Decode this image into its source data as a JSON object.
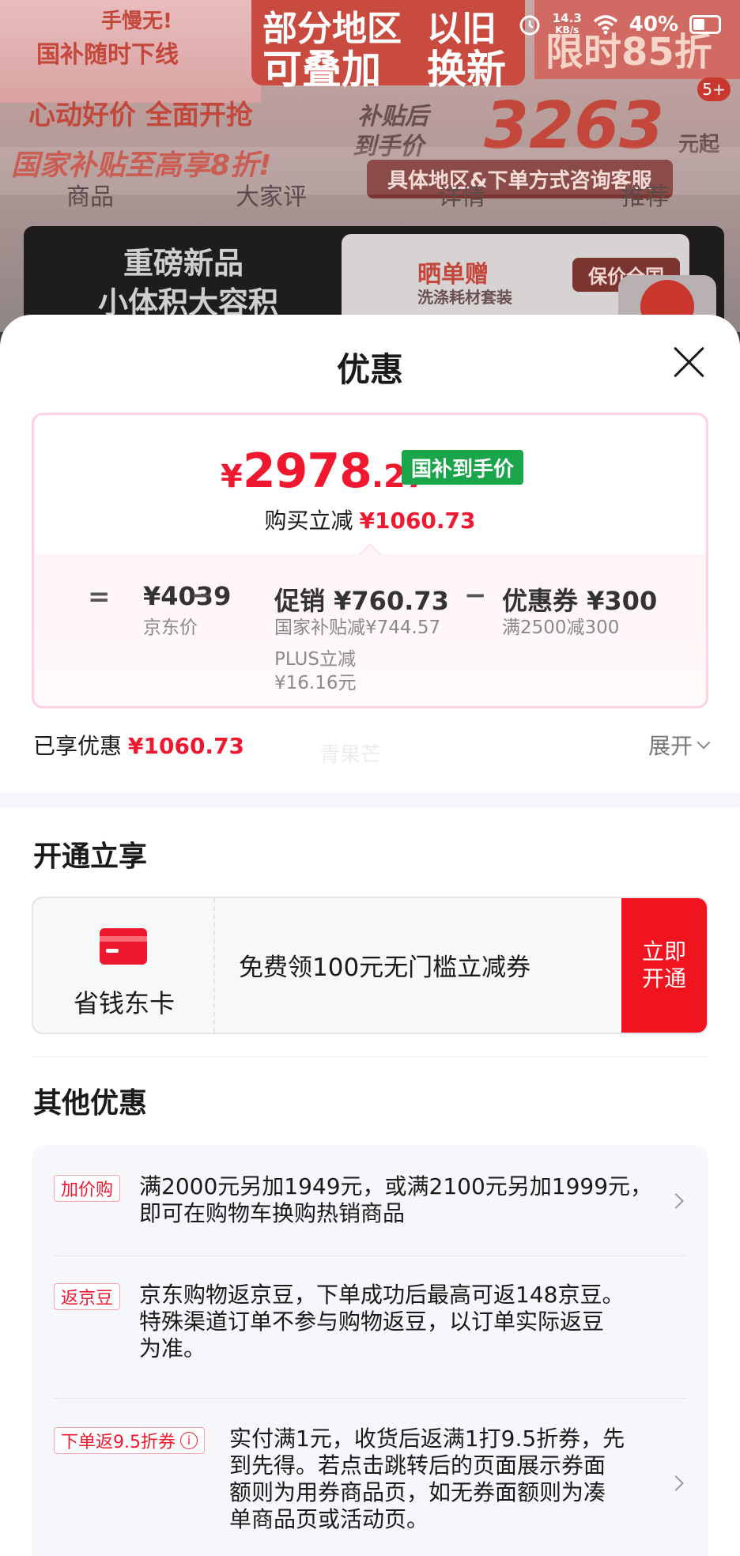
{
  "background": {
    "banner": {
      "left_top": "手慢无!",
      "left_main": "国补随时下线",
      "center_line1": "部分地区",
      "center_line2": "可叠加",
      "center_right1": "以旧",
      "center_right2": "换新",
      "right": "限时85折"
    },
    "slogan": "心动好价 全面开抢",
    "subsidy_text": "国家补贴至高享8折!",
    "after_subsidy_label_1": "补贴后",
    "after_subsidy_label_2": "到手价",
    "after_subsidy_price": "3263",
    "after_subsidy_unit": "元起",
    "consult_text": "具体地区&下单方式咨询客服",
    "badge": "5+",
    "nav_tabs": [
      "商品",
      "大家评",
      "详情",
      "推荐"
    ],
    "promo_left_1": "重磅新品",
    "promo_left_2": "小体积大容积",
    "promo_gift_title": "晒单赠",
    "promo_gift_sub": "洗涤耗材套装",
    "promo_pill": "保价全国"
  },
  "status_bar": {
    "speed_value": "14.3",
    "speed_unit": "KB/s",
    "battery": "40%"
  },
  "sheet": {
    "title": "优惠",
    "price": {
      "yen": "¥",
      "integer": "2978",
      "decimal": ".27",
      "tag": "国补到手价",
      "discount_label": "购买立减",
      "discount_value": "¥1060.73"
    },
    "breakdown": {
      "equals": "=",
      "minus": "−",
      "jd_price": "¥4039",
      "jd_price_label": "京东价",
      "promo": "促销 ¥760.73",
      "promo_sub_1": "国家补贴减¥744.57",
      "promo_sub_2": "PLUS立减",
      "promo_sub_3": "¥16.16元",
      "coupon": "优惠券 ¥300",
      "coupon_sub": "满2500减300"
    },
    "enjoyed_label": "已享优惠",
    "enjoyed_value": "¥1060.73",
    "ghost_text": "青果芒",
    "expand_label": "展开",
    "open_section": {
      "title": "开通立享",
      "card_name": "省钱东卡",
      "card_desc": "免费领100元无门槛立减券",
      "btn_line1": "立即",
      "btn_line2": "开通"
    },
    "other_section": {
      "title": "其他优惠",
      "items": [
        {
          "tag": "加价购",
          "line1": "满2000元另加1949元，或满2100元另加1999元，",
          "line2": "即可在购物车换购热销商品"
        },
        {
          "tag": "返京豆",
          "line1": "京东购物返京豆，下单成功后最高可返148京豆。",
          "line2": "特殊渠道订单不参与购物返豆，以订单实际返豆",
          "line3": "为准。"
        },
        {
          "tag": "下单返9.5折券",
          "line1": "实付满1元，收货后返满1打9.5折券，先",
          "line2": "到先得。若点击跳转后的页面展示券面",
          "line3": "额则为用券商品页，如无券面额则为凑",
          "line4": "单商品页或活动页。"
        }
      ]
    }
  },
  "colors": {
    "accent_red": "#f0182f",
    "tag_green": "#1aa54b"
  }
}
